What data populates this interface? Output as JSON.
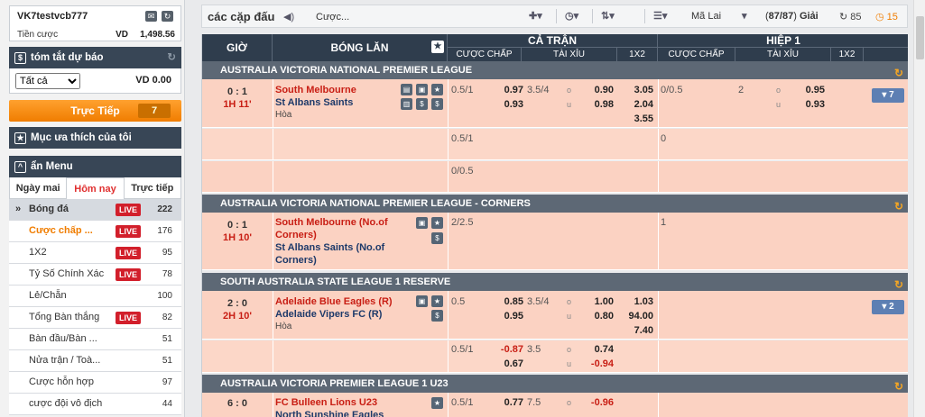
{
  "account": {
    "username": "VK7testvcb777",
    "credit_label": "Tiền cược",
    "currency": "VD",
    "credit_value": "1,498.56"
  },
  "summary": {
    "title": "tóm tắt dự báo",
    "select_value": "Tất cả",
    "amount": "VD 0.00"
  },
  "live": {
    "label": "Trực Tiếp",
    "count": "7"
  },
  "favorites": {
    "label": "Mục ưa thích của tôi"
  },
  "menu": {
    "label": "ẩn Menu",
    "tabs": [
      "Ngày mai",
      "Hôm nay",
      "Trực tiếp"
    ]
  },
  "sports": {
    "main": {
      "label": "Bóng đá",
      "badge": "LIVE",
      "count": "222"
    },
    "items": [
      {
        "label": "Cược chấp ...",
        "badge": "LIVE",
        "count": "176"
      },
      {
        "label": "1X2",
        "badge": "LIVE",
        "count": "95"
      },
      {
        "label": "Tỷ Số Chính Xác",
        "badge": "LIVE",
        "count": "78"
      },
      {
        "label": "Lẻ/Chẵn",
        "badge": "",
        "count": "100"
      },
      {
        "label": "Tổng Bàn thắng",
        "badge": "LIVE",
        "count": "82"
      },
      {
        "label": "Bàn đầu/Bàn ...",
        "badge": "",
        "count": "51"
      },
      {
        "label": "Nửa trận / Toà...",
        "badge": "",
        "count": "51"
      },
      {
        "label": "Cược hỗn hợp",
        "badge": "",
        "count": "97"
      },
      {
        "label": "cược đội vô địch",
        "badge": "",
        "count": "44"
      }
    ]
  },
  "toolbar": {
    "title": "các cặp đấu",
    "bet_type": "Cược...",
    "league": "Mã Lai",
    "count_open": "(",
    "count_val": "87/87",
    "count_close": ")",
    "count_label": "Giải",
    "refresh1": "85",
    "refresh2": "15"
  },
  "table": {
    "headers": {
      "time": "GIỜ",
      "match": "BÓNG LĂN",
      "full": "CẢ TRẬN",
      "half": "HIỆP 1",
      "hdp": "CƯỢC CHẤP",
      "ou": "TÀI XỈU",
      "x12": "1X2"
    },
    "leagues": [
      "AUSTRALIA VICTORIA NATIONAL PREMIER LEAGUE",
      "AUSTRALIA VICTORIA NATIONAL PREMIER LEAGUE - CORNERS",
      "SOUTH AUSTRALIA STATE LEAGUE 1 RESERVE",
      "AUSTRALIA VICTORIA PREMIER LEAGUE 1 U23"
    ],
    "m1": {
      "score": "0 : 1",
      "time": "1H 11'",
      "home": "South Melbourne",
      "away": "St Albans Saints",
      "draw": "Hòa",
      "hdp": "0.5/1",
      "h1": "0.97",
      "h2": "0.93",
      "ou": "3.5/4",
      "o1": "0.90",
      "o2": "0.98",
      "x1": "3.05",
      "x2": "2.04",
      "x3": "3.55",
      "fh_hdp": "0/0.5",
      "fh_ou": "2",
      "fh_o1": "0.95",
      "fh_o2": "0.93",
      "more": "7",
      "r2_hdp": "0.5/1",
      "r2_fh": "0",
      "r3_hdp": "0/0.5"
    },
    "m2": {
      "score": "0 : 1",
      "time": "1H 10'",
      "home": "South Melbourne (No.of Corners)",
      "away": "St Albans Saints (No.of Corners)",
      "hdp": "2/2.5",
      "fh_hdp": "1"
    },
    "m3": {
      "score": "2 : 0",
      "time": "2H 10'",
      "home": "Adelaide Blue Eagles (R)",
      "away": "Adelaide Vipers FC (R)",
      "draw": "Hòa",
      "hdp": "0.5",
      "h1": "0.85",
      "h2": "0.95",
      "ou": "3.5/4",
      "o1": "1.00",
      "o2": "0.80",
      "x1": "1.03",
      "x2": "94.00",
      "x3": "7.40",
      "more": "2",
      "r2_hdp": "0.5/1",
      "r2_h1": "-0.87",
      "r2_h2": "0.67",
      "r2_ou": "3.5",
      "r2_o1": "0.74",
      "r2_o2": "-0.94"
    },
    "m4": {
      "score": "6 : 0",
      "home": "FC Bulleen Lions U23",
      "away": "North Sunshine Eagles",
      "hdp": "0.5/1",
      "h1": "0.77",
      "ou": "7.5",
      "o1": "-0.96"
    },
    "ou_labels": {
      "o": "o",
      "u": "u"
    }
  }
}
